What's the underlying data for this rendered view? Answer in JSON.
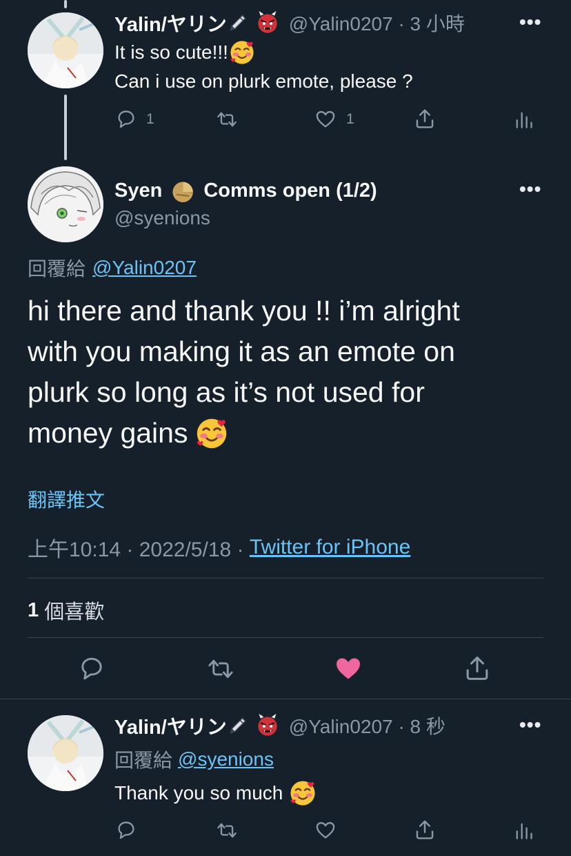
{
  "tweets": [
    {
      "display_name": "Yalin/ヤリン",
      "handle_time": "@Yalin0207 · 3 小時",
      "line1": "It is so cute!!!",
      "line2": "Can i use on plurk emote, please ?",
      "reply_count": "1",
      "like_count": "1"
    },
    {
      "display_name": "Syen",
      "name_suffix": "Comms open (1/2)",
      "handle": "@syenions",
      "reply_prefix": "回覆給",
      "reply_to": "@Yalin0207",
      "body_line1": "hi there and thank you !! i’m alright",
      "body_line2": "with you making it as an emote on",
      "body_line3": "plurk so long as it’s not used for",
      "body_line4": "money gains",
      "translate": "翻譯推文",
      "time": "上午10:14 · 2022/5/18 · ",
      "source": "Twitter for iPhone",
      "likes_number": "1",
      "likes_label": " 個喜歡",
      "liked": true
    },
    {
      "display_name": "Yalin/ヤリン",
      "handle_time": "@Yalin0207 · 8 秒",
      "reply_prefix": "回覆給",
      "reply_to": "@syenions",
      "body": "Thank you so much"
    }
  ],
  "more_label": "•••",
  "colors": {
    "background": "#15202b",
    "accent": "#6cc3f7",
    "like": "#f0679e",
    "muted": "#8b98a5"
  }
}
